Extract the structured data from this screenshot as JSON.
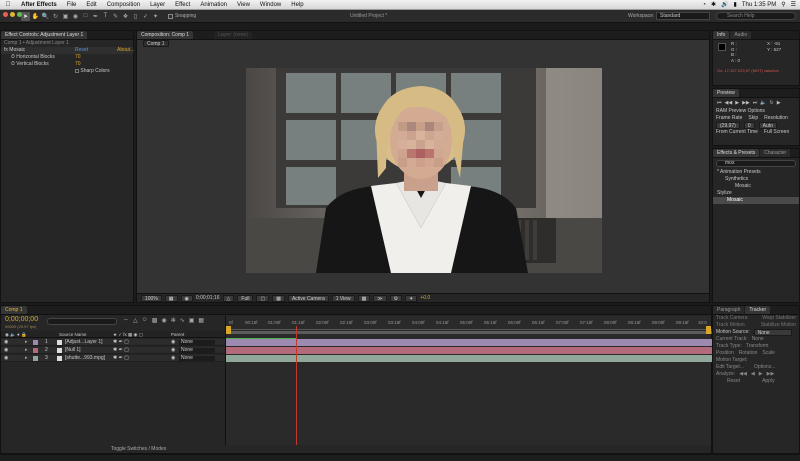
{
  "menubar": {
    "app": "After Effects",
    "items": [
      "File",
      "Edit",
      "Composition",
      "Layer",
      "Effect",
      "Animation",
      "View",
      "Window",
      "Help"
    ],
    "title": "Untitled Project *",
    "clock": "Thu 1:35 PM"
  },
  "toolbar": {
    "snapping_label": "Snapping",
    "workspace_label": "Workspace:",
    "workspace_value": "Standard",
    "search_placeholder": "Search Help"
  },
  "effect_controls": {
    "tab_label": "Effect Controls: Adjustment Layer 1",
    "breadcrumb": "Comp 1 • Adjustment Layer 1",
    "effect_name": "Mosaic",
    "reset": "Reset",
    "about": "About...",
    "params": [
      {
        "label": "Horizontal Blocks",
        "value": "70"
      },
      {
        "label": "Vertical Blocks",
        "value": "70"
      }
    ],
    "sharp_colors": "Sharp Colors"
  },
  "composition": {
    "tab_label": "Composition: Comp 1",
    "layer_tab": "Layer: (none)",
    "subtab": "Comp 1",
    "zoom": "100%",
    "timecode": "0;00;01;16",
    "quality": "Full",
    "camera": "Active Camera",
    "views": "1 View",
    "exposure": "+0.0"
  },
  "info": {
    "tabs": [
      "Info",
      "Audio"
    ],
    "rgb": [
      "R :",
      "G :",
      "B :",
      "A : 0"
    ],
    "x": "X : -91",
    "y": "Y : 527",
    "status": "Go, 17,327,229,57 (MOT) valuelon"
  },
  "preview": {
    "tab": "Preview",
    "ram_options": "RAM Preview Options",
    "frame_rate_label": "Frame Rate",
    "skip_label": "Skip",
    "resolution_label": "Resolution",
    "frame_rate": "(29.97)",
    "skip": "0",
    "resolution": "Auto",
    "from_current": "From Current Time",
    "full_screen": "Full Screen"
  },
  "effects_presets": {
    "tabs": [
      "Effects & Presets",
      "Character"
    ],
    "search_value": "mos",
    "tree": [
      {
        "label": "* Animation Presets",
        "level": 0
      },
      {
        "label": "Synthetics",
        "level": 1
      },
      {
        "label": "Mosaic",
        "level": 2
      },
      {
        "label": "Stylize",
        "level": 0
      },
      {
        "label": "Mosaic",
        "level": 1,
        "selected": true
      }
    ]
  },
  "timeline": {
    "tab": "Comp 1",
    "timecode": "0;00;00;00",
    "fps": "00000 (29.97 fps)",
    "search_placeholder": "",
    "col_source": "Source Name",
    "col_parent": "Parent",
    "ruler": [
      "0f",
      "00:15f",
      "01:00f",
      "01:15f",
      "02:00f",
      "02:15f",
      "03:00f",
      "03:15f",
      "04:00f",
      "04:15f",
      "05:00f",
      "05:15f",
      "06:00f",
      "06:15f",
      "07:00f",
      "07:15f",
      "08:00f",
      "08:15f",
      "09:00f",
      "09:15f",
      "10:0"
    ],
    "layers": [
      {
        "num": "1",
        "name": "[Adjust...Layer 1]",
        "parent": "None"
      },
      {
        "num": "2",
        "name": "[Null 1]",
        "parent": "None"
      },
      {
        "num": "3",
        "name": "[shutte...993.mpg]",
        "parent": "None"
      }
    ],
    "toggle_label": "Toggle Switches / Modes"
  },
  "tracker": {
    "tabs": [
      "Paragraph",
      "Tracker"
    ],
    "track_camera": "Track Camera",
    "warp_stabilizer": "Warp Stabilizer",
    "track_motion": "Track Motion",
    "stabilize_motion": "Stabilize Motion",
    "motion_source_label": "Motion Source:",
    "motion_source": "None",
    "current_track_label": "Current Track:",
    "current_track": "None",
    "track_type_label": "Track Type:",
    "track_type": "Transform",
    "position": "Position",
    "rotation": "Rotation",
    "scale": "Scale",
    "motion_target": "Motion Target:",
    "edit_target": "Edit Target...",
    "options": "Options...",
    "analyze": "Analyze:",
    "reset": "Reset",
    "apply": "Apply"
  },
  "colors": {
    "accent": "#d9a728",
    "layer_adjust": "#9d8ab0",
    "layer_null": "#b36a7a",
    "layer_video": "#8fa89a",
    "workarea": "#5b5b5b",
    "playhead": "#c0392b"
  }
}
